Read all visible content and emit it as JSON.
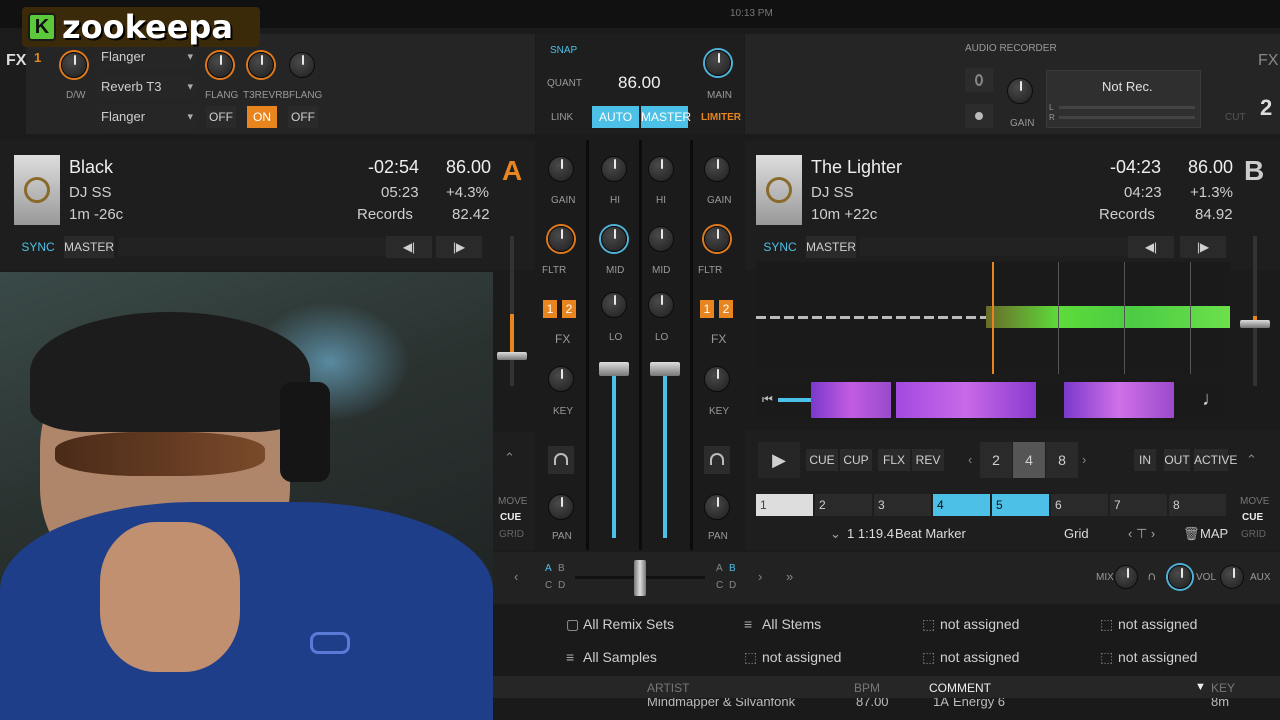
{
  "logo": {
    "badge": "K",
    "name": "zookeepa"
  },
  "fx": {
    "label": "FX",
    "unit": "1",
    "dw_label": "D/W",
    "slots": [
      "Flanger",
      "Reverb T3",
      "Flanger"
    ],
    "knob_labels": [
      "FLANG",
      "T3REVRB",
      "FLANG"
    ],
    "toggles": [
      "OFF",
      "ON",
      "OFF"
    ],
    "right_label": "FX"
  },
  "master": {
    "snap": "SNAP",
    "quant": "QUANT",
    "link": "LINK",
    "bpm": "86.00",
    "auto": "AUTO",
    "master": "MASTER",
    "main": "MAIN",
    "limiter": "LIMITER"
  },
  "recorder": {
    "title": "AUDIO RECORDER",
    "status": "Not Rec.",
    "gain": "GAIN",
    "l": "L",
    "r": "R",
    "cut": "CUT"
  },
  "deckA": {
    "letter": "A",
    "title": "Black",
    "artist": "DJ SS",
    "remaining": "-02:54",
    "time": "05:23",
    "bpm": "86.00",
    "pitch": "+4.3%",
    "label": "Records",
    "tempo": "82.42",
    "key": "1m -26c",
    "sync": "SYNC",
    "master": "MASTER"
  },
  "deckB": {
    "letter": "B",
    "title": "The Lighter",
    "artist": "DJ SS",
    "remaining": "-04:23",
    "time": "04:23",
    "bpm": "86.00",
    "pitch": "+1.3%",
    "label": "Records",
    "tempo": "84.92",
    "key": "10m +22c",
    "sync": "SYNC",
    "master": "MASTER"
  },
  "mixer": {
    "gain": "GAIN",
    "hi": "HI",
    "mid": "MID",
    "lo": "LO",
    "fltr": "FLTR",
    "fx": "FX",
    "key": "KEY",
    "pan": "PAN",
    "one": "1",
    "two": "2"
  },
  "transport": {
    "cue": "CUE",
    "cup": "CUP",
    "flx": "FLX",
    "rev": "REV",
    "loops": [
      "2",
      "4",
      "8"
    ],
    "in": "IN",
    "out": "OUT",
    "active": "ACTIVE"
  },
  "hotcues": [
    "1",
    "2",
    "3",
    "4",
    "5",
    "6",
    "7",
    "8"
  ],
  "beatmarker": {
    "pos": "1 1:19.4",
    "label": "Beat Marker",
    "grid": "Grid",
    "map": "MAP"
  },
  "side": {
    "move": "MOVE",
    "cue": "CUE",
    "grid": "GRID"
  },
  "crossfader": {
    "a": "A",
    "b": "B",
    "c": "C",
    "d": "D"
  },
  "cuebar": {
    "mix": "MIX",
    "vol": "VOL",
    "aux": "AUX"
  },
  "browser": {
    "row1": [
      "All Remix Sets",
      "All Stems",
      "not assigned",
      "not assigned"
    ],
    "row2": [
      "All Samples",
      "not assigned",
      "not assigned",
      "not assigned"
    ],
    "cols": [
      "ARTIST",
      "BPM",
      "COMMENT",
      "KEY"
    ],
    "peek": [
      "Mindmapper & Silvanfonk",
      "87.00",
      "1A",
      "Energy 6",
      "8m"
    ]
  },
  "clock": "10:13 PM"
}
